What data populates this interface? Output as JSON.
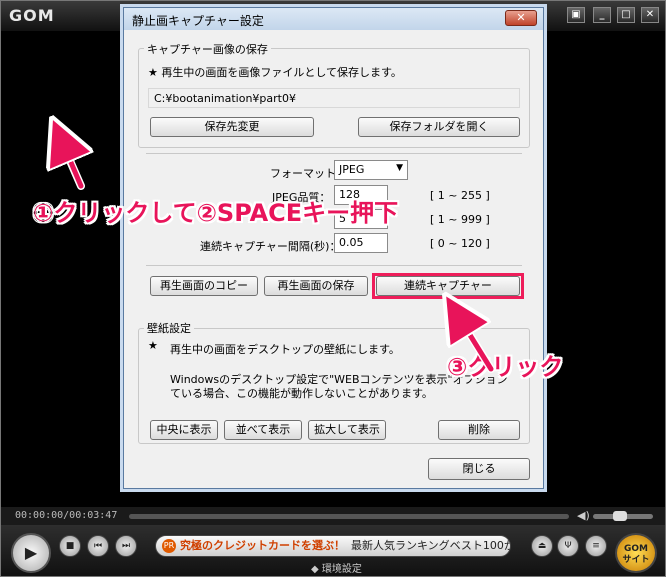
{
  "player": {
    "logo": "GOM",
    "time": "00:00:00/00:03:47",
    "ad_highlight": "究極のクレジットカードを選ぶ！",
    "ad_rest": "最新人気ランキングベスト100か",
    "ad_badge": "PR",
    "gom_site_top": "GOM",
    "gom_site_bottom": "サイト",
    "env_settings": "環境設定"
  },
  "dialog": {
    "title": "静止画キャプチャー設定",
    "close": "✕",
    "section1_title": "キャプチャー画像の保存",
    "section1_desc": "★ 再生中の画面を画像ファイルとして保存します。",
    "path": "C:¥bootanimation¥part0¥",
    "btn_change_dest": "保存先変更",
    "btn_open_folder": "保存フォルダを開く",
    "format_label": "フォーマット：",
    "format_value": "JPEG",
    "quality_label": "JPEG品質：",
    "quality_value": "128",
    "quality_range": "[ 1 ~ 255 ]",
    "count_value": "5",
    "count_range": "[ 1 ~ 999 ]",
    "interval_label": "連続キャプチャー間隔(秒)：",
    "interval_value": "0.05",
    "interval_range": "[ 0 ~ 120 ]",
    "btn_copy": "再生画面のコピー",
    "btn_save": "再生画面の保存",
    "btn_burst": "連続キャプチャー",
    "section2_title": "壁紙設定",
    "section2_star": "★",
    "section2_desc": "再生中の画面をデスクトップの壁紙にします。",
    "section2_note1": "Windowsのデスクトップ設定で\"WEBコンテンツを表示\"オプション",
    "section2_note2": "ている場合、この機能が動作しないことがあります。",
    "btn_center": "中央に表示",
    "btn_tile": "並べて表示",
    "btn_stretch": "拡大して表示",
    "btn_delete": "削除",
    "btn_close": "閉じる"
  },
  "annotations": {
    "step12": "①クリックして②SPACEキー押下",
    "step3": "③クリック",
    "color": "#e8145a"
  }
}
